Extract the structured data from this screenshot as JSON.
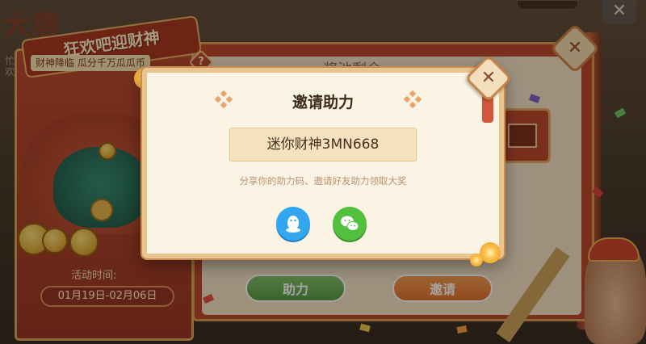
{
  "background": {
    "title": "大唐",
    "cut_text_1": "忙",
    "cut_text_2": "欢欢",
    "coin_counter": "",
    "banner_title": "狂欢吧迎财神",
    "banner_subtitle": "财神降临 瓜分千万瓜瓜币",
    "help_icon": "?",
    "right_heading": "奖池剩余",
    "activity_time_label": "活动时间:",
    "activity_time_value": "01月19日-02月06日",
    "help_button": "助力",
    "invite_button": "邀请",
    "close_icon": "close-icon"
  },
  "modal": {
    "title": "邀请助力",
    "code": "迷你财神3MN668",
    "hint": "分享你的助力码、邀请好友助力领取大奖",
    "share": [
      {
        "name": "qq",
        "icon": "qq-penguin-icon",
        "color": "#32a7f0"
      },
      {
        "name": "wechat",
        "icon": "wechat-icon",
        "color": "#53c03d"
      }
    ],
    "close_icon": "close-icon"
  },
  "colors": {
    "panel_red": "#b8462d",
    "gold_border": "#eac48f",
    "modal_bg": "#fbf3e4",
    "code_bg": "#f4e2bf"
  }
}
